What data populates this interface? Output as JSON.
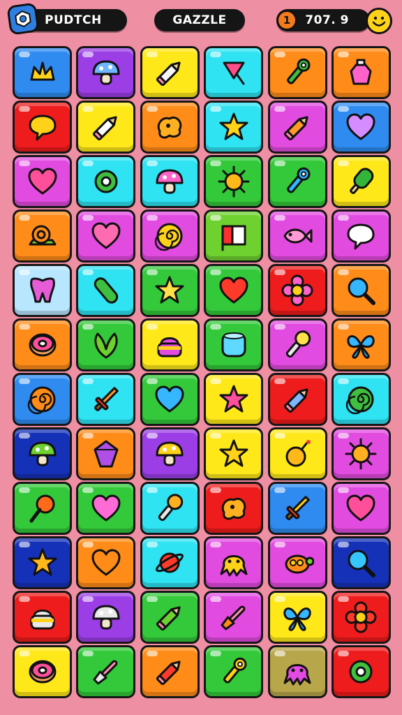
{
  "header": {
    "left_title": "PUDTCH",
    "center_title": "GAZZLE",
    "coin_badge": "1",
    "score": "707. 9"
  },
  "colors": {
    "background": "#ef8fa3",
    "pill": "#151515",
    "blue": "#2f8bf0",
    "purple": "#9b3ee6",
    "yellow": "#ffe81a",
    "cyan": "#2fe3f2",
    "orange": "#ff8c19",
    "red": "#ee1c1c",
    "magenta": "#e24be0",
    "green": "#33c93a",
    "lightgreen": "#6fd12f",
    "navy": "#1531b8",
    "pink": "#ff64c4",
    "paleblue": "#b9e6ff",
    "olive": "#b8a64a",
    "lime": "#b7ec2d"
  },
  "board": {
    "rows": [
      [
        {
          "color": "blue",
          "icon": "crown-icon",
          "fill": "#ffd21a"
        },
        {
          "color": "purple",
          "icon": "mushroom-icon",
          "fill": "#6fb6ff"
        },
        {
          "color": "yellow",
          "icon": "pencil-icon",
          "fill": "#f7f7f7"
        },
        {
          "color": "cyan",
          "icon": "candy-icon",
          "fill": "#ff4f8a"
        },
        {
          "color": "orange",
          "icon": "wrench-icon",
          "fill": "#3fbf3f"
        },
        {
          "color": "orange",
          "icon": "potion-icon",
          "fill": "#ff62c8"
        }
      ],
      [
        {
          "color": "red",
          "icon": "speech-bubble-icon",
          "fill": "#ffd21a"
        },
        {
          "color": "yellow",
          "icon": "pencil-icon",
          "fill": "#ffffff"
        },
        {
          "color": "orange",
          "icon": "blob-icon",
          "fill": "#ffb020"
        },
        {
          "color": "cyan",
          "icon": "star-icon",
          "fill": "#ffd21a"
        },
        {
          "color": "magenta",
          "icon": "pencil-icon",
          "fill": "#ff9a2a"
        },
        {
          "color": "blue",
          "icon": "heart-icon",
          "fill": "#d58cff"
        }
      ],
      [
        {
          "color": "magenta",
          "icon": "heart-icon",
          "fill": "#ff4f9a"
        },
        {
          "color": "cyan",
          "icon": "ring-icon",
          "fill": "#3fbf3f"
        },
        {
          "color": "cyan",
          "icon": "mushroom-icon",
          "fill": "#ff62c8"
        },
        {
          "color": "green",
          "icon": "sun-icon",
          "fill": "#ffb81a"
        },
        {
          "color": "green",
          "icon": "wrench-icon",
          "fill": "#2fb6ff"
        },
        {
          "color": "yellow",
          "icon": "popsicle-icon",
          "fill": "#33b53a"
        }
      ],
      [
        {
          "color": "orange",
          "icon": "snail-icon",
          "fill": "#ff8c19"
        },
        {
          "color": "magenta",
          "icon": "heart-icon",
          "fill": "#ff6bb0"
        },
        {
          "color": "magenta",
          "icon": "spiral-icon",
          "fill": "#ffd21a"
        },
        {
          "color": "lightgreen",
          "icon": "flag-icon",
          "fill": "#ff2f2f"
        },
        {
          "color": "magenta",
          "icon": "fish-icon",
          "fill": "#ff9ad6"
        },
        {
          "color": "magenta",
          "icon": "speech-bubble-icon",
          "fill": "#ffffff"
        }
      ],
      [
        {
          "color": "paleblue",
          "icon": "tooth-icon",
          "fill": "#e65bd6"
        },
        {
          "color": "cyan",
          "icon": "pickle-icon",
          "fill": "#3fbf3f"
        },
        {
          "color": "green",
          "icon": "star-icon",
          "fill": "#ffe04a"
        },
        {
          "color": "green",
          "icon": "heart-icon",
          "fill": "#ff3a2a"
        },
        {
          "color": "red",
          "icon": "flower-icon",
          "fill": "#ff62c8"
        },
        {
          "color": "orange",
          "icon": "magnifier-icon",
          "fill": "#35b6ff"
        }
      ],
      [
        {
          "color": "orange",
          "icon": "donut-icon",
          "fill": "#ff4f9a"
        },
        {
          "color": "green",
          "icon": "leaf-icon",
          "fill": "#6fd12f"
        },
        {
          "color": "yellow",
          "icon": "cake-icon",
          "fill": "#e24be0"
        },
        {
          "color": "green",
          "icon": "cup-icon",
          "fill": "#5fd9ff"
        },
        {
          "color": "magenta",
          "icon": "microphone-icon",
          "fill": "#ffe04a"
        },
        {
          "color": "orange",
          "icon": "butterfly-icon",
          "fill": "#35b6ff"
        }
      ],
      [
        {
          "color": "blue",
          "icon": "spiral-icon",
          "fill": "#ff8c19"
        },
        {
          "color": "cyan",
          "icon": "sword-icon",
          "fill": "#ff9a2a"
        },
        {
          "color": "green",
          "icon": "heart-icon",
          "fill": "#35b6ff"
        },
        {
          "color": "yellow",
          "icon": "star-icon",
          "fill": "#ff4f9a"
        },
        {
          "color": "red",
          "icon": "pencil-icon",
          "fill": "#7fb6ff"
        },
        {
          "color": "cyan",
          "icon": "spiral-icon",
          "fill": "#3fbf3f"
        }
      ],
      [
        {
          "color": "navy",
          "icon": "mushroom-icon",
          "fill": "#6fd12f"
        },
        {
          "color": "orange",
          "icon": "gem-icon",
          "fill": "#b04ee8"
        },
        {
          "color": "purple",
          "icon": "mushroom-icon",
          "fill": "#ffd21a"
        },
        {
          "color": "yellow",
          "icon": "star-icon",
          "fill": "#ffd21a"
        },
        {
          "color": "yellow",
          "icon": "bomb-icon",
          "fill": "#ffb81a"
        },
        {
          "color": "magenta",
          "icon": "sun-icon",
          "fill": "#ffb020"
        }
      ],
      [
        {
          "color": "green",
          "icon": "lollipop-icon",
          "fill": "#ff6a1a"
        },
        {
          "color": "green",
          "icon": "heart-icon",
          "fill": "#ff6bd6"
        },
        {
          "color": "cyan",
          "icon": "microphone-icon",
          "fill": "#ffb020"
        },
        {
          "color": "red",
          "icon": "blob-icon",
          "fill": "#ffb020"
        },
        {
          "color": "blue",
          "icon": "sword-icon",
          "fill": "#ffd21a"
        },
        {
          "color": "magenta",
          "icon": "heart-icon",
          "fill": "#ff4f9a"
        }
      ],
      [
        {
          "color": "navy",
          "icon": "star-icon",
          "fill": "#ffb81a"
        },
        {
          "color": "orange",
          "icon": "heart-icon",
          "fill": "#ff8c19"
        },
        {
          "color": "cyan",
          "icon": "planet-icon",
          "fill": "#ff3a2a"
        },
        {
          "color": "magenta",
          "icon": "octopus-icon",
          "fill": "#ffd21a"
        },
        {
          "color": "magenta",
          "icon": "turtle-icon",
          "fill": "#ff8c19"
        },
        {
          "color": "navy",
          "icon": "magnifier-icon",
          "fill": "#35c6ff"
        }
      ],
      [
        {
          "color": "red",
          "icon": "cake-icon",
          "fill": "#e8e8e8"
        },
        {
          "color": "purple",
          "icon": "mushroom-icon",
          "fill": "#e8e8e8"
        },
        {
          "color": "green",
          "icon": "pencil-icon",
          "fill": "#6fd12f"
        },
        {
          "color": "magenta",
          "icon": "brush-icon",
          "fill": "#ff8c19"
        },
        {
          "color": "yellow",
          "icon": "butterfly-icon",
          "fill": "#35b6ff"
        },
        {
          "color": "red",
          "icon": "flower-icon",
          "fill": "#ff3a2a"
        }
      ],
      [
        {
          "color": "yellow",
          "icon": "donut-icon",
          "fill": "#ff4f9a"
        },
        {
          "color": "green",
          "icon": "brush-icon",
          "fill": "#e8e8e8"
        },
        {
          "color": "orange",
          "icon": "pencil-icon",
          "fill": "#ff3a2a"
        },
        {
          "color": "green",
          "icon": "wrench-icon",
          "fill": "#ffd21a"
        },
        {
          "color": "olive",
          "icon": "octopus-icon",
          "fill": "#e24be0"
        },
        {
          "color": "red",
          "icon": "ring-icon",
          "fill": "#3fbf3f"
        }
      ]
    ]
  }
}
